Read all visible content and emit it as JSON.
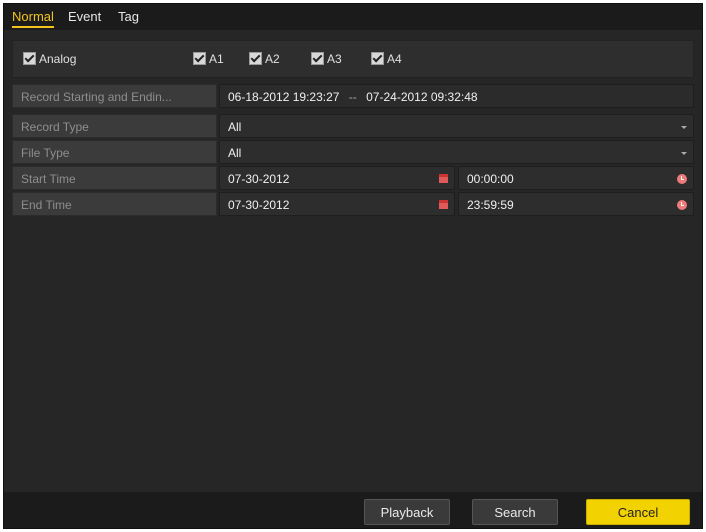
{
  "tabs": [
    {
      "label": "Normal",
      "active": true
    },
    {
      "label": "Event",
      "active": false
    },
    {
      "label": "Tag",
      "active": false
    }
  ],
  "channels": {
    "group_label": "Analog",
    "items": [
      "A1",
      "A2",
      "A3",
      "A4"
    ]
  },
  "record_range": {
    "label": "Record Starting and Endin...",
    "start": "06-18-2012 19:23:27",
    "separator": "--",
    "end": "07-24-2012 09:32:48"
  },
  "fields": {
    "record_type": {
      "label": "Record Type",
      "value": "All"
    },
    "file_type": {
      "label": "File Type",
      "value": "All"
    },
    "start_time": {
      "label": "Start Time",
      "date": "07-30-2012",
      "time": "00:00:00"
    },
    "end_time": {
      "label": "End Time",
      "date": "07-30-2012",
      "time": "23:59:59"
    }
  },
  "buttons": {
    "playback": "Playback",
    "search": "Search",
    "cancel": "Cancel"
  },
  "colors": {
    "accent": "#f2c51d",
    "primary_button": "#f2d200"
  }
}
